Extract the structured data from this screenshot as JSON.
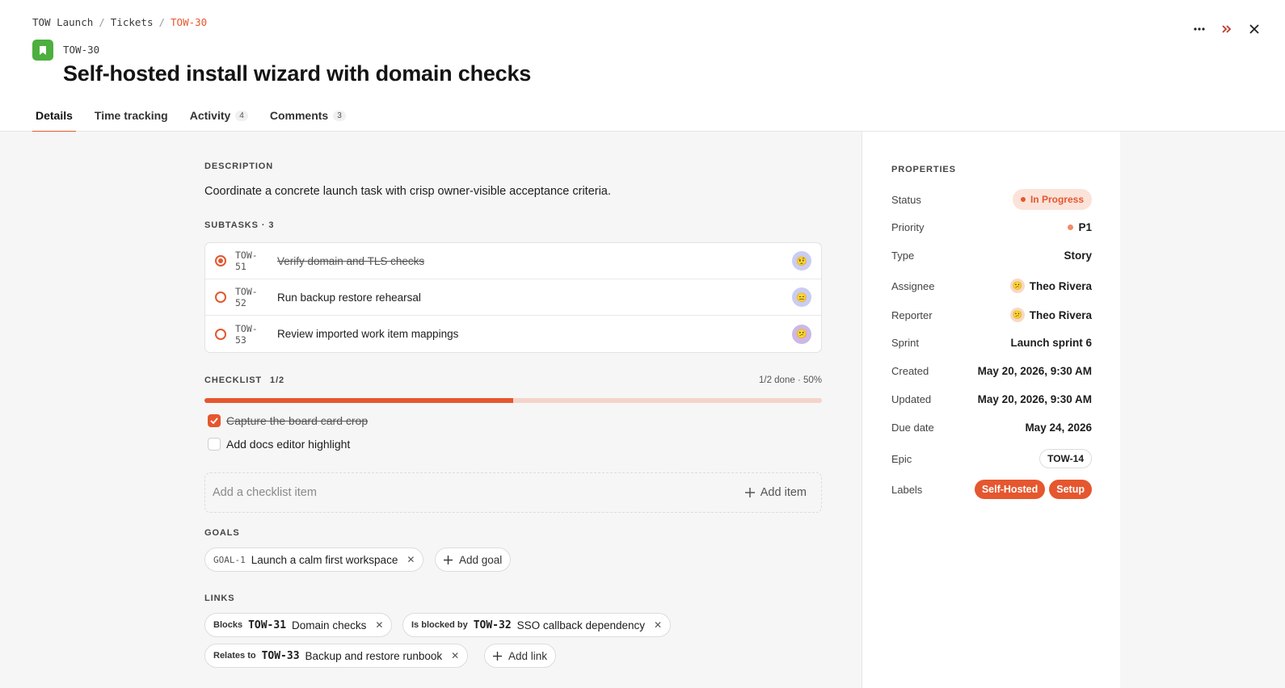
{
  "breadcrumb": {
    "project": "TOW Launch",
    "sep1": "/",
    "section": "Tickets",
    "sep2": "/",
    "current": "TOW-30"
  },
  "ticket": {
    "key": "TOW-30",
    "title": "Self-hosted install wizard with domain checks",
    "type_icon": "bookmark-icon"
  },
  "actions": {
    "more": "more-horizontal-icon",
    "collapse": "chevrons-right-icon",
    "close": "close-icon"
  },
  "tabs": [
    {
      "label": "Details",
      "count": null
    },
    {
      "label": "Time tracking",
      "count": null
    },
    {
      "label": "Activity",
      "count": "4"
    },
    {
      "label": "Comments",
      "count": "3"
    }
  ],
  "description": {
    "label": "DESCRIPTION",
    "text": "Coordinate a concrete launch task with crisp owner-visible acceptance criteria."
  },
  "subtasks": {
    "label": "SUBTASKS · 3",
    "items": [
      {
        "key": "TOW-51",
        "title": "Verify domain and TLS checks",
        "done": true,
        "avatar": "🤨"
      },
      {
        "key": "TOW-52",
        "title": "Run backup restore rehearsal",
        "done": false,
        "avatar": "😑"
      },
      {
        "key": "TOW-53",
        "title": "Review imported work item mappings",
        "done": false,
        "avatar": "😕"
      }
    ]
  },
  "checklist": {
    "label": "CHECKLIST",
    "count": "1/2",
    "meta": "1/2 done · 50%",
    "progress_fraction": 0.5,
    "items": [
      {
        "text": "Capture the board card crop",
        "checked": true
      },
      {
        "text": "Add docs editor highlight",
        "checked": false
      }
    ],
    "add_placeholder": "Add a checklist item",
    "add_button": "Add item"
  },
  "goals": {
    "label": "GOALS",
    "items": [
      {
        "key": "GOAL-1",
        "title": "Launch a calm first workspace"
      }
    ],
    "add_button": "Add goal"
  },
  "links": {
    "label": "LINKS",
    "items": [
      {
        "relation": "Blocks",
        "key": "TOW-31",
        "title": "Domain checks"
      },
      {
        "relation": "Is blocked by",
        "key": "TOW-32",
        "title": "SSO callback dependency"
      },
      {
        "relation": "Relates to",
        "key": "TOW-33",
        "title": "Backup and restore runbook"
      }
    ],
    "add_button": "Add link"
  },
  "properties": {
    "label": "PROPERTIES",
    "status": {
      "key": "Status",
      "value": "In Progress"
    },
    "priority": {
      "key": "Priority",
      "value": "P1"
    },
    "type": {
      "key": "Type",
      "value": "Story"
    },
    "assignee": {
      "key": "Assignee",
      "value": "Theo Rivera"
    },
    "reporter": {
      "key": "Reporter",
      "value": "Theo Rivera"
    },
    "sprint": {
      "key": "Sprint",
      "value": "Launch sprint 6"
    },
    "created": {
      "key": "Created",
      "value": "May 20, 2026, 9:30 AM"
    },
    "updated": {
      "key": "Updated",
      "value": "May 20, 2026, 9:30 AM"
    },
    "due": {
      "key": "Due date",
      "value": "May 24, 2026"
    },
    "epic": {
      "key": "Epic",
      "value": "TOW-14"
    },
    "labels": {
      "key": "Labels",
      "values": [
        "Self-Hosted",
        "Setup"
      ]
    }
  },
  "colors": {
    "accent": "#e5572e",
    "type_icon_bg": "#4caf3e",
    "status_bg": "#fbe3da"
  }
}
